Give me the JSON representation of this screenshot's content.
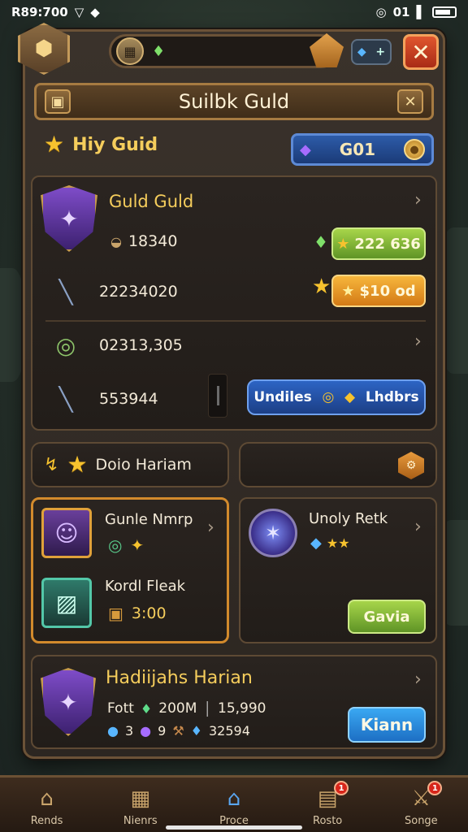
{
  "status_bar": {
    "time": "R89:700",
    "right_text": "01"
  },
  "top_bar": {
    "badge_text": "+"
  },
  "title_bar": {
    "title": "Suilbk Guld"
  },
  "my_guild": {
    "label": "Hiy Guid",
    "currency_value": "G01"
  },
  "guild_panel": {
    "name": "Guld Guld",
    "row1_value": "18340",
    "row1_button": "222 636",
    "row2_value": "22234020",
    "row2_button": "$10 od",
    "row3_value": "02313,305",
    "row4_value": "553944",
    "split_left": "Undiles",
    "split_right": "Lhdbrs"
  },
  "section2": {
    "label": "Doio Hariam"
  },
  "card_left": {
    "item1_title": "Gunle Nmrp",
    "item2_title": "Kordl Fleak",
    "item2_value": "3:00"
  },
  "card_right": {
    "title": "Unoly Retk",
    "button": "Gavia"
  },
  "bottom_panel": {
    "title": "Hadiijahs Harian",
    "stat_label": "Fott",
    "stat_value": "200M",
    "stat_value2": "15,990",
    "sub_value1": "3",
    "sub_value2": "9",
    "sub_value3": "32594",
    "button": "Kiann"
  },
  "nav": {
    "items": [
      {
        "label": "Rends",
        "icon": "house-icon"
      },
      {
        "label": "Nienrs",
        "icon": "grid-icon"
      },
      {
        "label": "Proce",
        "icon": "castle-icon"
      },
      {
        "label": "Rosto",
        "icon": "chest-icon",
        "badge": "1"
      },
      {
        "label": "Songe",
        "icon": "sword-icon",
        "badge": "1"
      }
    ]
  },
  "colors": {
    "accent_gold": "#f5cd5c",
    "frame_brown": "#6b5237",
    "button_blue": "#2d5ba8",
    "button_green": "#a7d54a",
    "button_orange": "#f7b63c",
    "close_red": "#e0562e"
  }
}
